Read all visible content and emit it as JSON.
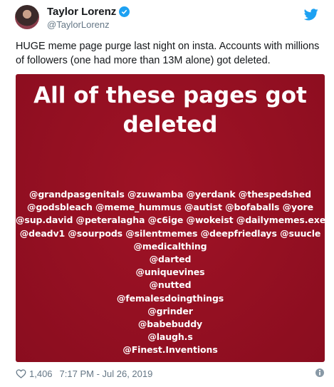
{
  "author": {
    "name": "Taylor Lorenz",
    "handle": "@TaylorLorenz"
  },
  "tweet": {
    "text": "HUGE meme page purge last night on insta. Accounts with millions of followers (one had more than 13M alone) got deleted."
  },
  "media": {
    "title_lines": [
      "All of these pages got",
      "deleted"
    ],
    "handles": [
      "@grandpasgenitals @zuwamba @yerdank @thespedshed",
      "@godsbleach @meme_hummus @autist @bofaballs @yore",
      "@sup.david @peteralagha @c6ige @wokeist @dailymemes.exe",
      "@deadv1 @sourpods @silentmemes @deepfriedlays @suucle",
      "@medicalthing",
      "@darted",
      "@uniquevines",
      "@nutted",
      "@femalesdoingthings",
      "@grinder",
      "@babebuddy",
      "@laugh.s",
      "@Finest.Inventions"
    ]
  },
  "footer": {
    "likes": "1,406",
    "timestamp": "7:17 PM - Jul 26, 2019"
  },
  "icons": {
    "verified": "verified-badge-icon",
    "twitter": "twitter-bird-icon",
    "like": "heart-icon",
    "info": "info-icon"
  },
  "colors": {
    "brand": "#1da1f2",
    "media_bg": "#930f22",
    "secondary_text": "#657786"
  }
}
